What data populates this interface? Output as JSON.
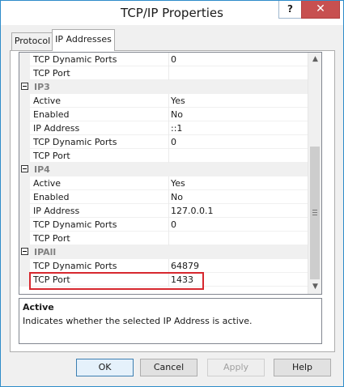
{
  "window": {
    "title": "TCP/IP Properties",
    "help_label": "?",
    "close_label": "✕"
  },
  "tabs": [
    {
      "label": "Protocol",
      "selected": false
    },
    {
      "label": "IP Addresses",
      "selected": true
    }
  ],
  "grid_rows": [
    {
      "kind": "prop",
      "label": "TCP Dynamic Ports",
      "value": "0"
    },
    {
      "kind": "prop",
      "label": "TCP Port",
      "value": ""
    },
    {
      "kind": "cat",
      "label": "IP3"
    },
    {
      "kind": "prop",
      "label": "Active",
      "value": "Yes"
    },
    {
      "kind": "prop",
      "label": "Enabled",
      "value": "No"
    },
    {
      "kind": "prop",
      "label": "IP Address",
      "value": "::1"
    },
    {
      "kind": "prop",
      "label": "TCP Dynamic Ports",
      "value": "0"
    },
    {
      "kind": "prop",
      "label": "TCP Port",
      "value": ""
    },
    {
      "kind": "cat",
      "label": "IP4"
    },
    {
      "kind": "prop",
      "label": "Active",
      "value": "Yes"
    },
    {
      "kind": "prop",
      "label": "Enabled",
      "value": "No"
    },
    {
      "kind": "prop",
      "label": "IP Address",
      "value": "127.0.0.1"
    },
    {
      "kind": "prop",
      "label": "TCP Dynamic Ports",
      "value": "0"
    },
    {
      "kind": "prop",
      "label": "TCP Port",
      "value": ""
    },
    {
      "kind": "cat",
      "label": "IPAll"
    },
    {
      "kind": "prop",
      "label": "TCP Dynamic Ports",
      "value": "64879"
    },
    {
      "kind": "prop",
      "label": "TCP Port",
      "value": "1433"
    }
  ],
  "description": {
    "title": "Active",
    "text": "Indicates whether the selected IP Address is active."
  },
  "buttons": {
    "ok": "OK",
    "cancel": "Cancel",
    "apply": "Apply",
    "help": "Help"
  },
  "icons": {
    "expander": "collapse-minus-icon",
    "scroll_up": "scroll-up-arrow-icon",
    "scroll_down": "scroll-down-arrow-icon",
    "thumb_grip": "scrollbar-grip-icon"
  },
  "colors": {
    "highlight_border": "#d7282f",
    "close_button": "#c75050",
    "window_border": "#2e8cc9"
  }
}
